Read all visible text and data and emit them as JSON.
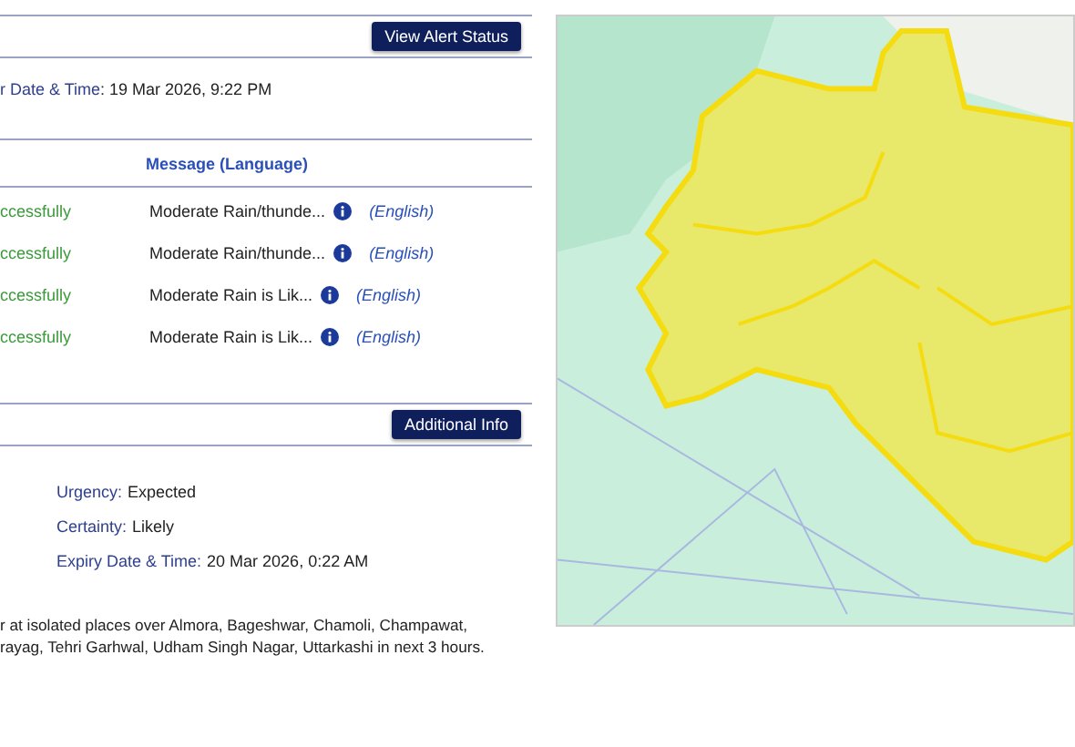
{
  "alert_header": {
    "button": "View Alert Status"
  },
  "effective": {
    "label": "r Date & Time",
    "value": ": 19 Mar 2026, 9:22 PM"
  },
  "messages_table": {
    "columns": [
      "Message (Language)"
    ],
    "rows": [
      {
        "status": "ccessfully",
        "message": "Moderate Rain/thunde...",
        "language": "(English)"
      },
      {
        "status": "ccessfully",
        "message": "Moderate Rain/thunde...",
        "language": "(English)"
      },
      {
        "status": "ccessfully",
        "message": "Moderate Rain is Lik...",
        "language": "(English)"
      },
      {
        "status": "ccessfully",
        "message": "Moderate Rain is Lik...",
        "language": "(English)"
      }
    ]
  },
  "info_header": {
    "button": "Additional Info"
  },
  "details": [
    {
      "label": "Urgency:",
      "value": "Expected"
    },
    {
      "label": "Certainty:",
      "value": "Likely"
    },
    {
      "label": "Expiry Date & Time:",
      "value": "20 Mar 2026, 0:22 AM"
    }
  ],
  "description": [
    "r at isolated places over Almora, Bageshwar, Chamoli, Champawat,",
    "rayag, Tehri Garhwal, Udham Singh Nagar, Uttarkashi in next 3 hours."
  ]
}
